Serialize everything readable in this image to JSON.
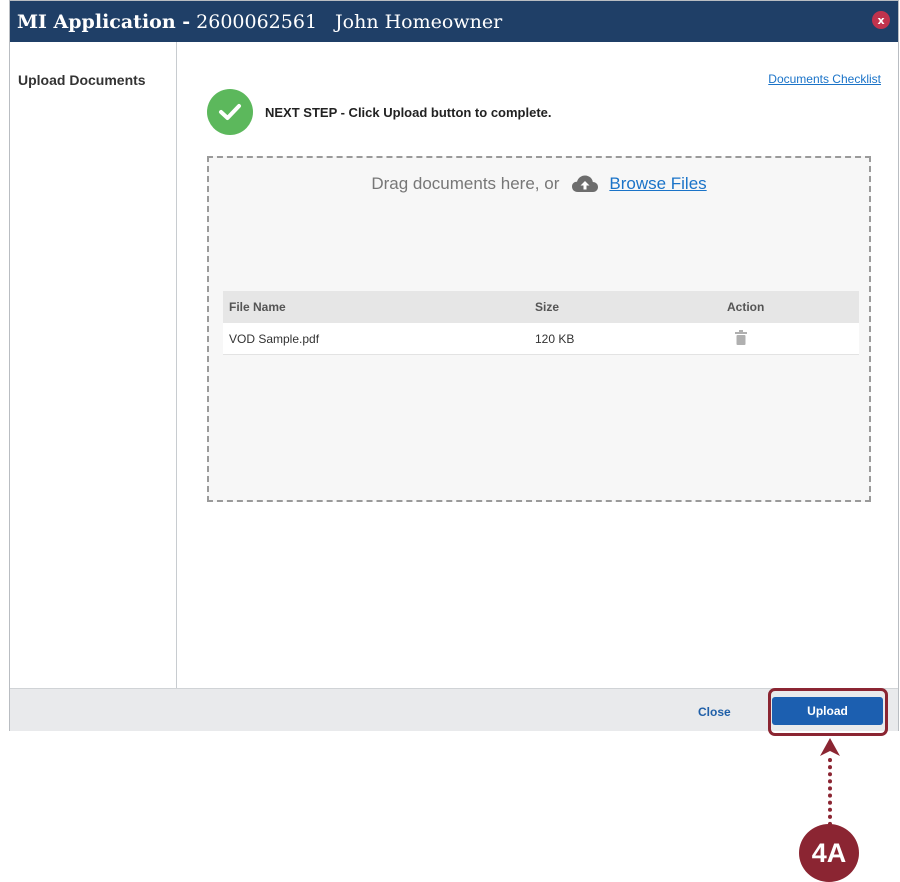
{
  "window": {
    "title_app": "MI Application -",
    "title_number": "2600062561",
    "title_name": "John Homeowner",
    "close_glyph": "x"
  },
  "sidebar": {
    "label": "Upload Documents"
  },
  "main": {
    "checklist_link": "Documents Checklist",
    "step_text": "NEXT STEP - Click Upload button to complete.",
    "dropzone": {
      "drag_text": "Drag documents here, or",
      "browse_link": "Browse Files"
    },
    "table": {
      "headers": [
        "File Name",
        "Size",
        "Action"
      ],
      "rows": [
        {
          "file_name": "VOD Sample.pdf",
          "size": "120 KB",
          "action_icon": "trash-icon"
        }
      ]
    }
  },
  "footer": {
    "close_label": "Close",
    "upload_label": "Upload"
  },
  "annotation": {
    "callout_label": "4A"
  },
  "colors": {
    "titlebar": "#1f3f67",
    "accent_blue": "#1c5fb0",
    "success_green": "#5cb85c",
    "annotation": "#8b2532"
  }
}
